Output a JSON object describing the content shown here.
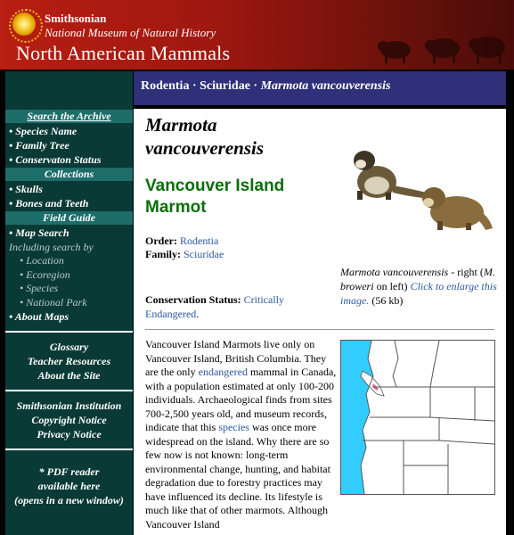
{
  "header": {
    "brand": "Smithsonian",
    "museum": "National Museum of Natural History",
    "title": "North American Mammals"
  },
  "breadcrumb": {
    "order": "Rodentia",
    "family": "Sciuridae",
    "species": "Marmota vancouverensis",
    "separator": " · "
  },
  "nav": {
    "search_archive": "Search the Archive",
    "species_name": "• Species Name",
    "family_tree": "• Family Tree",
    "conservation_status": "• Conservaton Status",
    "collections": "Collections",
    "skulls": "• Skulls",
    "bones_teeth": "• Bones and Teeth",
    "field_guide": "Field Guide",
    "map_search": "• Map Search",
    "including": "Including search by",
    "location": "• Location",
    "ecoregion": "• Ecoregion",
    "species": "• Species",
    "national_park": "• National Park",
    "about_maps": "• About Maps",
    "glossary": "Glossary",
    "teacher_resources": "Teacher Resources",
    "about_site": "About the Site",
    "smithsonian_institution": "Smithsonian Institution",
    "copyright": "Copyright Notice",
    "privacy": "Privacy Notice",
    "pdf_line1": "* PDF reader",
    "pdf_line2": "available here",
    "pdf_line3": "(opens in a new window)"
  },
  "species": {
    "scientific_name": "Marmota vancouverensis",
    "common_name": "Vancouver Island Marmot",
    "order_label": "Order:",
    "order_value": "Rodentia",
    "family_label": "Family:",
    "family_value": "Sciuridae",
    "status_label": "Conservation Status:",
    "status_value": "Critically Endangered",
    "status_end": "."
  },
  "caption": {
    "name": "Marmota vancouverensis",
    "right": " - right",
    "open": "(",
    "other": "M. broweri",
    "left": " on left)",
    "enlarge": "Click to enlarge this image.",
    "size": " (56 kb)"
  },
  "description": {
    "p1": "Vancouver Island Marmots live only on Vancouver Island, British Columbia. They are the only ",
    "link_endangered": "endangered",
    "p2": " mammal in Canada, with a population estimated at only 100-200 individuals. Archaeological finds from sites 700-2,500 years old, and museum records, indicate that this ",
    "link_species": "species",
    "p3": " was once more widespread on the island. Why there are so few now is not known: long-term environmental change, hunting, and habitat degradation due to forestry practices may have influenced its decline. Its lifestyle is much like that of other marmots. Although Vancouver Island"
  },
  "colors": {
    "header_red": "#b81e12",
    "nav_bg": "#0a3a36",
    "nav_head": "#1d6e6a",
    "crumb_bg": "#2f2f7a",
    "common_green": "#0a6e0a",
    "link_blue": "#2a58a0",
    "range_pink": "#e06c8a"
  }
}
